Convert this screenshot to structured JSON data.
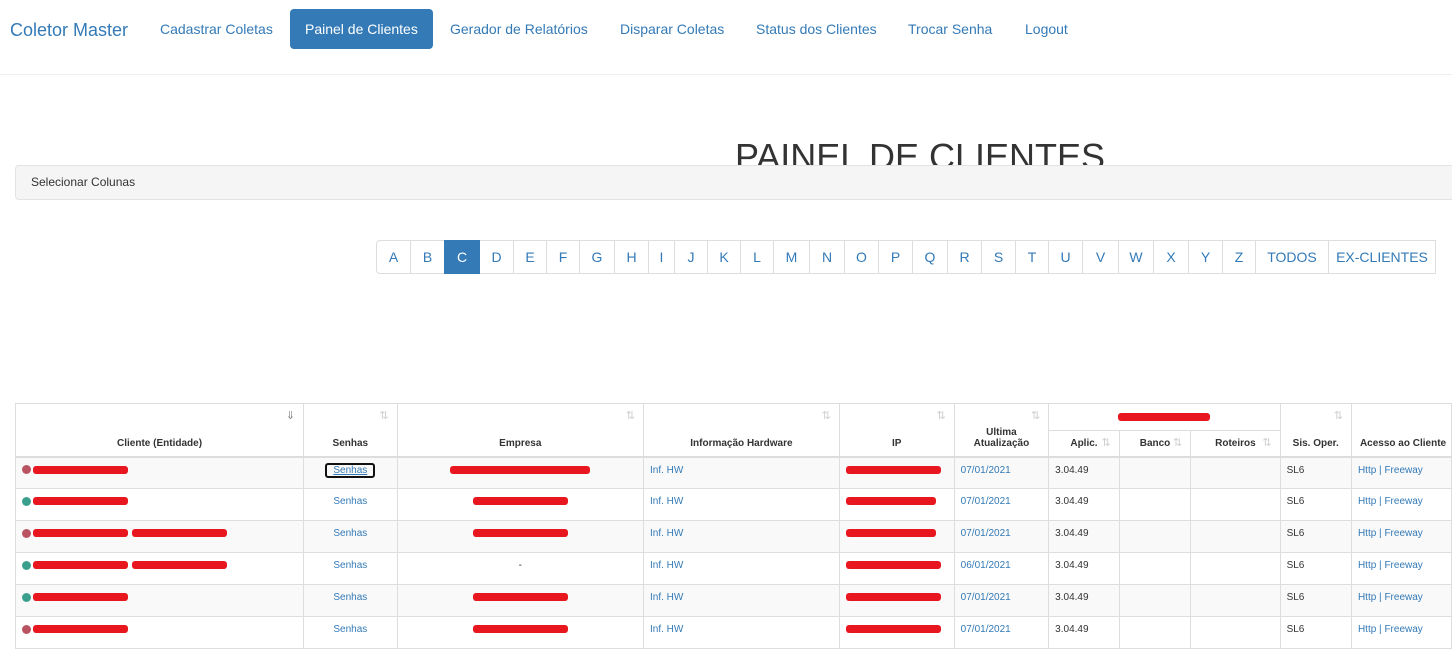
{
  "nav": {
    "brand": "Coletor Master",
    "items": [
      {
        "label": "Cadastrar Coletas",
        "active": false
      },
      {
        "label": "Painel de Clientes",
        "active": true
      },
      {
        "label": "Gerador de Relatórios",
        "active": false
      },
      {
        "label": "Disparar Coletas",
        "active": false
      },
      {
        "label": "Status dos Clientes",
        "active": false
      },
      {
        "label": "Trocar Senha",
        "active": false
      },
      {
        "label": "Logout",
        "active": false
      }
    ]
  },
  "page": {
    "title": "PAINEL DE CLIENTES",
    "column_selector": "Selecionar Colunas"
  },
  "pagination": {
    "items": [
      "A",
      "B",
      "C",
      "D",
      "E",
      "F",
      "G",
      "H",
      "I",
      "J",
      "K",
      "L",
      "M",
      "N",
      "O",
      "P",
      "Q",
      "R",
      "S",
      "T",
      "U",
      "V",
      "W",
      "X",
      "Y",
      "Z",
      "TODOS",
      "EX-CLIENTES"
    ],
    "active": "C"
  },
  "table": {
    "headers": {
      "cliente": "Cliente (Entidade)",
      "senhas": "Senhas",
      "empresa": "Empresa",
      "hardware": "Informação Hardware",
      "ip": "IP",
      "ultima": "Ultima Atualização",
      "aplic": "Aplic.",
      "banco": "Banco",
      "roteiros": "Roteiros",
      "so": "Sis. Oper.",
      "acesso": "Acesso ao Cliente"
    },
    "sort_icon": "⇅",
    "sort_active_icon": "⇓",
    "rows": [
      {
        "status": "red",
        "senhas": "Senhas",
        "empresa_text": "",
        "hw": "Inf. HW",
        "date": "07/01/2021",
        "aplic": "3.04.49",
        "banco": "",
        "roteiros": "",
        "so": "SL6",
        "http": "Http",
        "sep": " | ",
        "freeway": "Freeway"
      },
      {
        "status": "green",
        "senhas": "Senhas",
        "empresa_text": "",
        "hw": "Inf. HW",
        "date": "07/01/2021",
        "aplic": "3.04.49",
        "banco": "",
        "roteiros": "",
        "so": "SL6",
        "http": "Http",
        "sep": " | ",
        "freeway": "Freeway"
      },
      {
        "status": "red",
        "senhas": "Senhas",
        "empresa_text": "",
        "hw": "Inf. HW",
        "date": "07/01/2021",
        "aplic": "3.04.49",
        "banco": "",
        "roteiros": "",
        "so": "SL6",
        "http": "Http",
        "sep": " | ",
        "freeway": "Freeway"
      },
      {
        "status": "green",
        "senhas": "Senhas",
        "empresa_text": "-",
        "hw": "Inf. HW",
        "date": "06/01/2021",
        "aplic": "3.04.49",
        "banco": "",
        "roteiros": "",
        "so": "SL6",
        "http": "Http",
        "sep": " | ",
        "freeway": "Freeway"
      },
      {
        "status": "green",
        "senhas": "Senhas",
        "empresa_text": "",
        "hw": "Inf. HW",
        "date": "07/01/2021",
        "aplic": "3.04.49",
        "banco": "",
        "roteiros": "",
        "so": "SL6",
        "http": "Http",
        "sep": " | ",
        "freeway": "Freeway"
      },
      {
        "status": "red",
        "senhas": "Senhas",
        "empresa_text": "",
        "hw": "Inf. HW",
        "date": "07/01/2021",
        "aplic": "3.04.49",
        "banco": "",
        "roteiros": "",
        "so": "SL6",
        "http": "Http",
        "sep": " | ",
        "freeway": "Freeway"
      }
    ]
  },
  "colors": {
    "primary": "#337ab7",
    "status_red": "#b8535f",
    "status_green": "#3aa08d",
    "redaction": "#e8161f"
  }
}
